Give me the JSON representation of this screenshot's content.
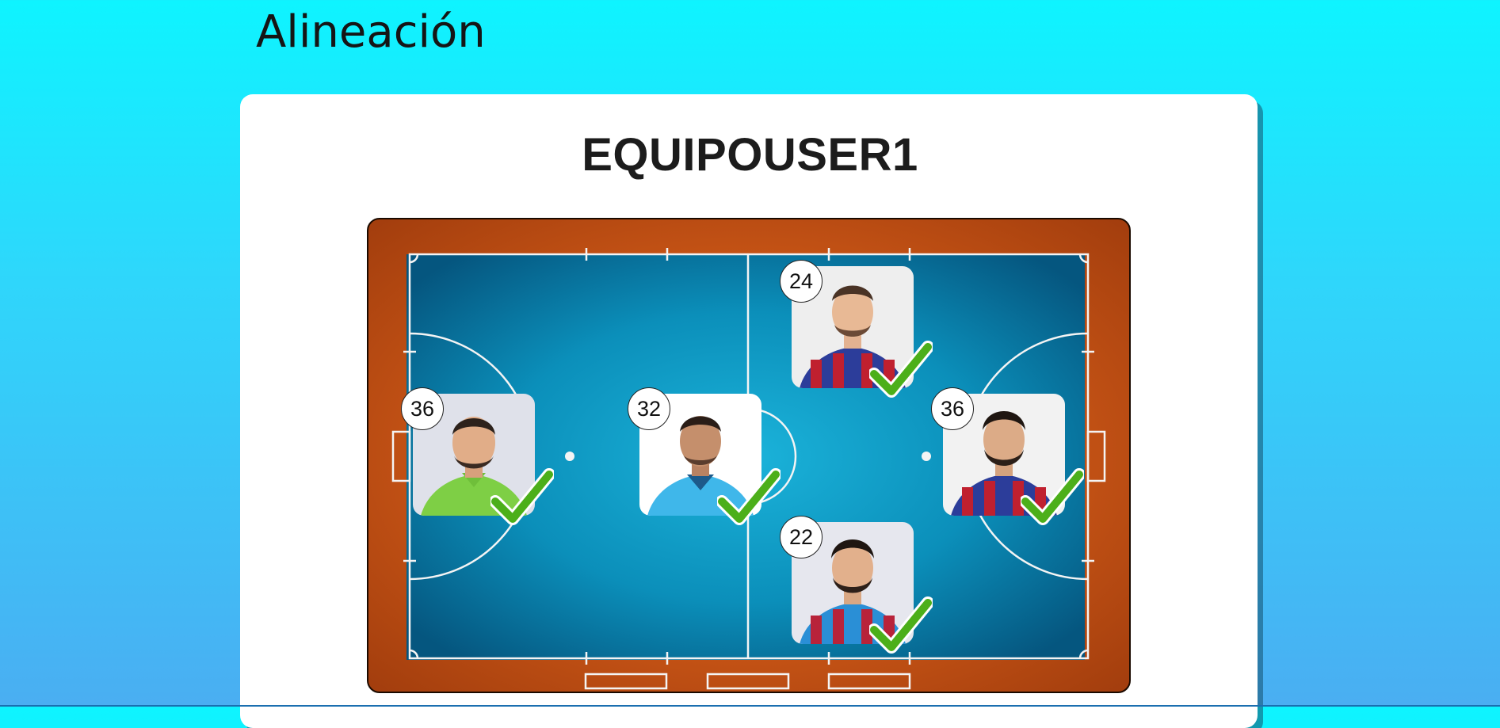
{
  "page": {
    "title": "Alineación"
  },
  "team": {
    "name": "EQUIPOUSER1"
  },
  "players": [
    {
      "number": "36",
      "kit": "green-goalkeeper",
      "selected": true
    },
    {
      "number": "32",
      "kit": "light-blue",
      "selected": true
    },
    {
      "number": "24",
      "kit": "blue-red-stripes",
      "selected": true
    },
    {
      "number": "22",
      "kit": "blue-red-stripes",
      "selected": true
    },
    {
      "number": "36",
      "kit": "blue-red-stripes",
      "selected": true
    }
  ],
  "colors": {
    "court": "#0f8fb7",
    "court_border": "#c85516",
    "check": "#4caf1a",
    "background_top": "#0ef4ff",
    "background_bottom": "#4aaef2"
  },
  "icons": {
    "selected": "check-icon"
  }
}
